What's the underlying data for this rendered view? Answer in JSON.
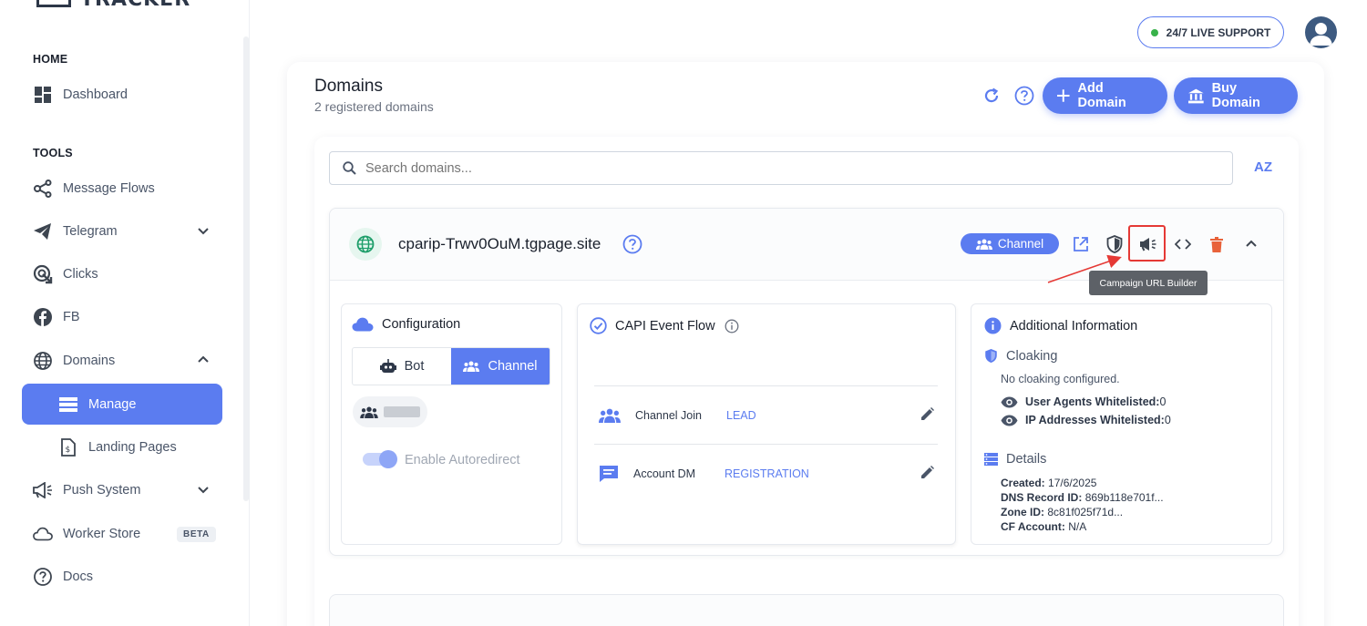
{
  "app": {
    "logo_text": "TRACKER"
  },
  "sidebar": {
    "sections": [
      {
        "label": "HOME"
      },
      {
        "label": "TOOLS"
      }
    ],
    "items": [
      {
        "label": "Dashboard",
        "icon": "dashboard-icon"
      },
      {
        "label": "Message Flows",
        "icon": "flow-icon"
      },
      {
        "label": "Telegram",
        "icon": "telegram-icon"
      },
      {
        "label": "Clicks",
        "icon": "clicks-icon"
      },
      {
        "label": "FB",
        "icon": "facebook-icon"
      },
      {
        "label": "Domains",
        "icon": "globe-icon"
      },
      {
        "label": "Manage",
        "icon": "list-icon"
      },
      {
        "label": "Landing Pages",
        "icon": "page-icon"
      },
      {
        "label": "Push System",
        "icon": "megaphone-icon"
      },
      {
        "label": "Worker Store",
        "icon": "cloud-icon",
        "badge": "BETA"
      },
      {
        "label": "Docs",
        "icon": "help-icon"
      }
    ]
  },
  "topbar": {
    "support_label": "24/7 LIVE SUPPORT"
  },
  "page": {
    "title": "Domains",
    "subtitle": "2 registered domains",
    "add_domain_label": "Add Domain",
    "buy_domain_label": "Buy Domain"
  },
  "search": {
    "placeholder": "Search domains..."
  },
  "sort_label": "AZ",
  "domain": {
    "name": "cparip-Trwv0OuM.tgpage.site",
    "type_chip": "Channel",
    "tooltip": "Campaign URL Builder"
  },
  "configuration": {
    "title": "Configuration",
    "options": [
      "Bot",
      "Channel"
    ],
    "selected": "Channel",
    "autoredirect_label": "Enable Autoredirect"
  },
  "capi": {
    "title": "CAPI Event Flow",
    "rows": [
      {
        "name": "Channel Join",
        "event": "LEAD"
      },
      {
        "name": "Account DM",
        "event": "REGISTRATION"
      }
    ]
  },
  "additional": {
    "title": "Additional Information",
    "cloaking_title": "Cloaking",
    "cloaking_status": "No cloaking configured.",
    "ua_label": "User Agents Whitelisted:",
    "ua_value": "0",
    "ip_label": "IP Addresses Whitelisted:",
    "ip_value": "0",
    "details_title": "Details",
    "created_label": "Created:",
    "created_value": "17/6/2025",
    "dns_label": "DNS Record ID:",
    "dns_value": "869b118e701f...",
    "zone_label": "Zone ID:",
    "zone_value": "8c81f025f71d...",
    "cf_label": "CF Account:",
    "cf_value": "N/A"
  },
  "colors": {
    "accent": "#5b7cf0",
    "danger": "#e8623a",
    "highlight": "#e53935",
    "green": "#38b24a"
  }
}
